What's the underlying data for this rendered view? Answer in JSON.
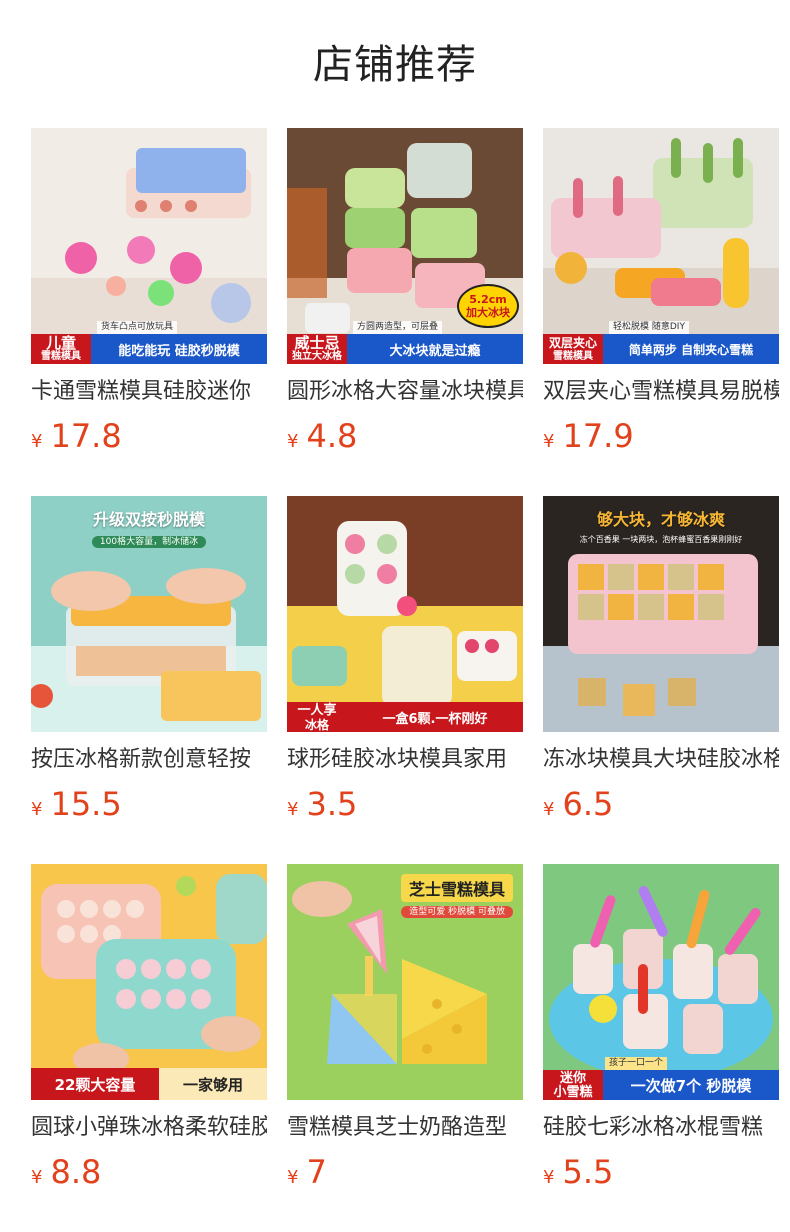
{
  "page": {
    "title": "店铺推荐"
  },
  "colors": {
    "price": "#e2421b",
    "banner_red": "#c8161d",
    "banner_blue": "#1a57c9"
  },
  "products": [
    {
      "title": "卡通雪糕模具硅胶迷你",
      "currency": "¥",
      "price": "17.8",
      "image": {
        "tag_line1": "儿童",
        "tag_line2": "雪糕模具",
        "slogan": "能吃能玩 硅胶秒脱模",
        "sub": "货车凸点可放玩具"
      }
    },
    {
      "title": "圆形冰格大容量冰块模具",
      "currency": "¥",
      "price": "4.8",
      "image": {
        "tag_line1": "威士忌",
        "tag_line2": "独立大冰格",
        "slogan": "大冰块就是过瘾",
        "sub": "方圆两造型，可层叠",
        "badge_line1": "5.2cm",
        "badge_line2": "加大冰块"
      }
    },
    {
      "title": "双层夹心雪糕模具易脱模",
      "currency": "¥",
      "price": "17.9",
      "image": {
        "tag_line1": "双层夹心",
        "tag_line2": "雪糕模具",
        "slogan": "简单两步 自制夹心雪糕",
        "sub": "轻松脱模 随意DIY"
      }
    },
    {
      "title": "按压冰格新款创意轻按",
      "currency": "¥",
      "price": "15.5",
      "image": {
        "top_text": "升级双按秒脱模",
        "top_sub": "100格大容量，制冰储冰"
      }
    },
    {
      "title": "球形硅胶冰块模具家用",
      "currency": "¥",
      "price": "3.5",
      "image": {
        "tag_line1": "一人享",
        "tag_line2": "冰格",
        "slogan": "一盒6颗.一杯刚好"
      }
    },
    {
      "title": "冻冰块模具大块硅胶冰格",
      "currency": "¥",
      "price": "6.5",
      "image": {
        "top_text": "够大块，才够冰爽",
        "top_sub": "冻个百香果 一块两块，泡杯蜂蜜百香果刚刚好"
      }
    },
    {
      "title": "圆球小弹珠冰格柔软硅胶",
      "currency": "¥",
      "price": "8.8",
      "image": {
        "slogan_left": "22颗大容量",
        "slogan_right": "一家够用"
      }
    },
    {
      "title": "雪糕模具芝士奶酪造型",
      "currency": "¥",
      "price": "7",
      "image": {
        "top_text": "芝士雪糕模具",
        "top_sub": "造型可爱 秒脱模 可叠放"
      }
    },
    {
      "title": "硅胶七彩冰格冰棍雪糕",
      "currency": "¥",
      "price": "5.5",
      "image": {
        "tag_line1": "迷你",
        "tag_line2": "小雪糕",
        "slogan": "一次做7个 秒脱模",
        "sub": "孩子一口一个"
      }
    }
  ]
}
